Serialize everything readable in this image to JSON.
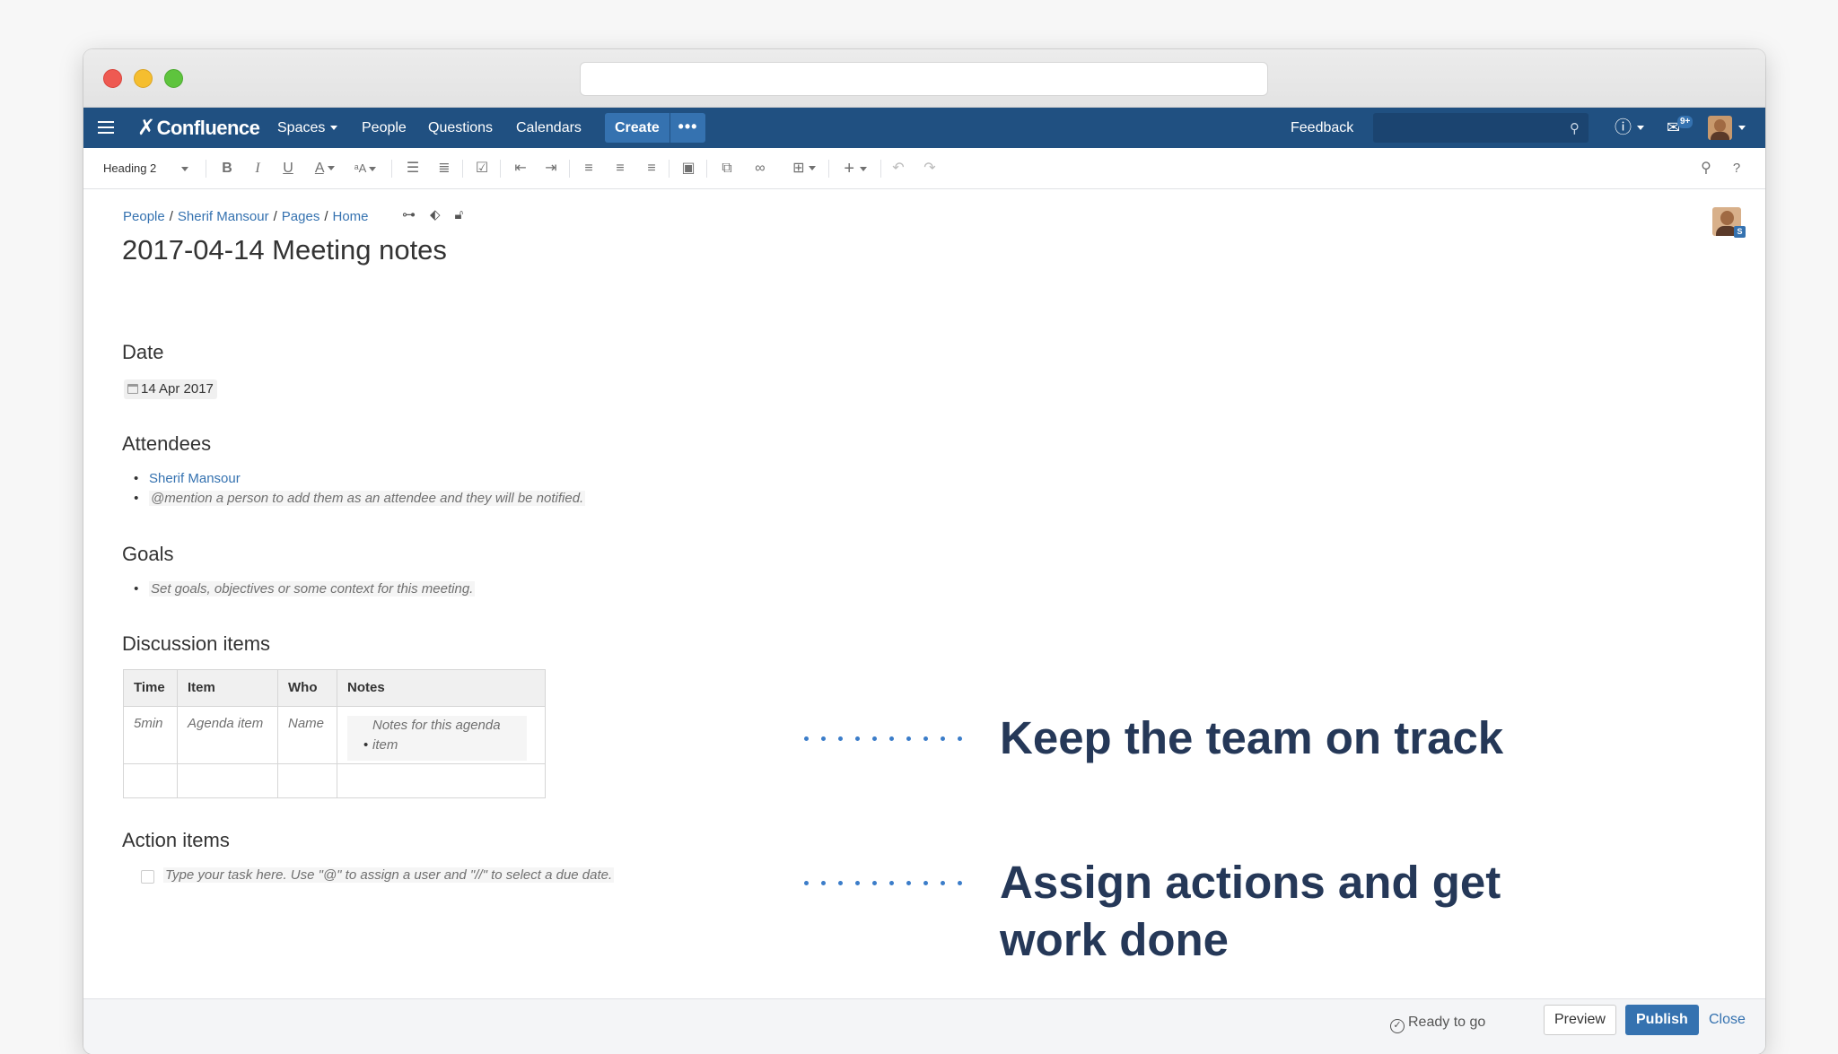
{
  "nav": {
    "logo": "Confluence",
    "spaces": "Spaces",
    "people": "People",
    "questions": "Questions",
    "calendars": "Calendars",
    "create": "Create",
    "more": "•••",
    "feedback": "Feedback",
    "search_placeholder": "",
    "notification_count": "9+"
  },
  "toolbar": {
    "style_select": "Heading 2",
    "bold": "B",
    "italic": "I",
    "underline": "U",
    "text_color": "A",
    "more_formatting": "ᵃA",
    "help": "?"
  },
  "breadcrumb": {
    "items": [
      "People",
      "Sherif Mansour",
      "Pages",
      "Home"
    ],
    "separator": "/"
  },
  "page": {
    "title": "2017-04-14 Meeting notes",
    "date_heading": "Date",
    "date_value": "14 Apr 2017",
    "attendees_heading": "Attendees",
    "attendees": [
      "Sherif Mansour",
      "@mention a person to add them as an attendee and they will be notified."
    ],
    "goals_heading": "Goals",
    "goals": [
      "Set goals, objectives or some context for this meeting."
    ],
    "discussion_heading": "Discussion items",
    "table": {
      "headers": [
        "Time",
        "Item",
        "Who",
        "Notes"
      ],
      "rows": [
        [
          "5min",
          "Agenda item",
          "Name",
          "Notes for this agenda item"
        ]
      ]
    },
    "action_heading": "Action items",
    "action_placeholder": "Type your task here. Use \"@\" to assign a user and \"//\" to select a due date.",
    "avatar_badge": "S"
  },
  "callouts": {
    "first": "Keep the team on track",
    "second_line1": "Assign actions and get",
    "second_line2": "work done"
  },
  "footer": {
    "status": "Ready to go",
    "preview": "Preview",
    "publish": "Publish",
    "close": "Close"
  },
  "colors": {
    "nav_bg": "#205081",
    "accent": "#3572b0",
    "callout_text": "#253858",
    "dots": "#3b7dc9"
  }
}
